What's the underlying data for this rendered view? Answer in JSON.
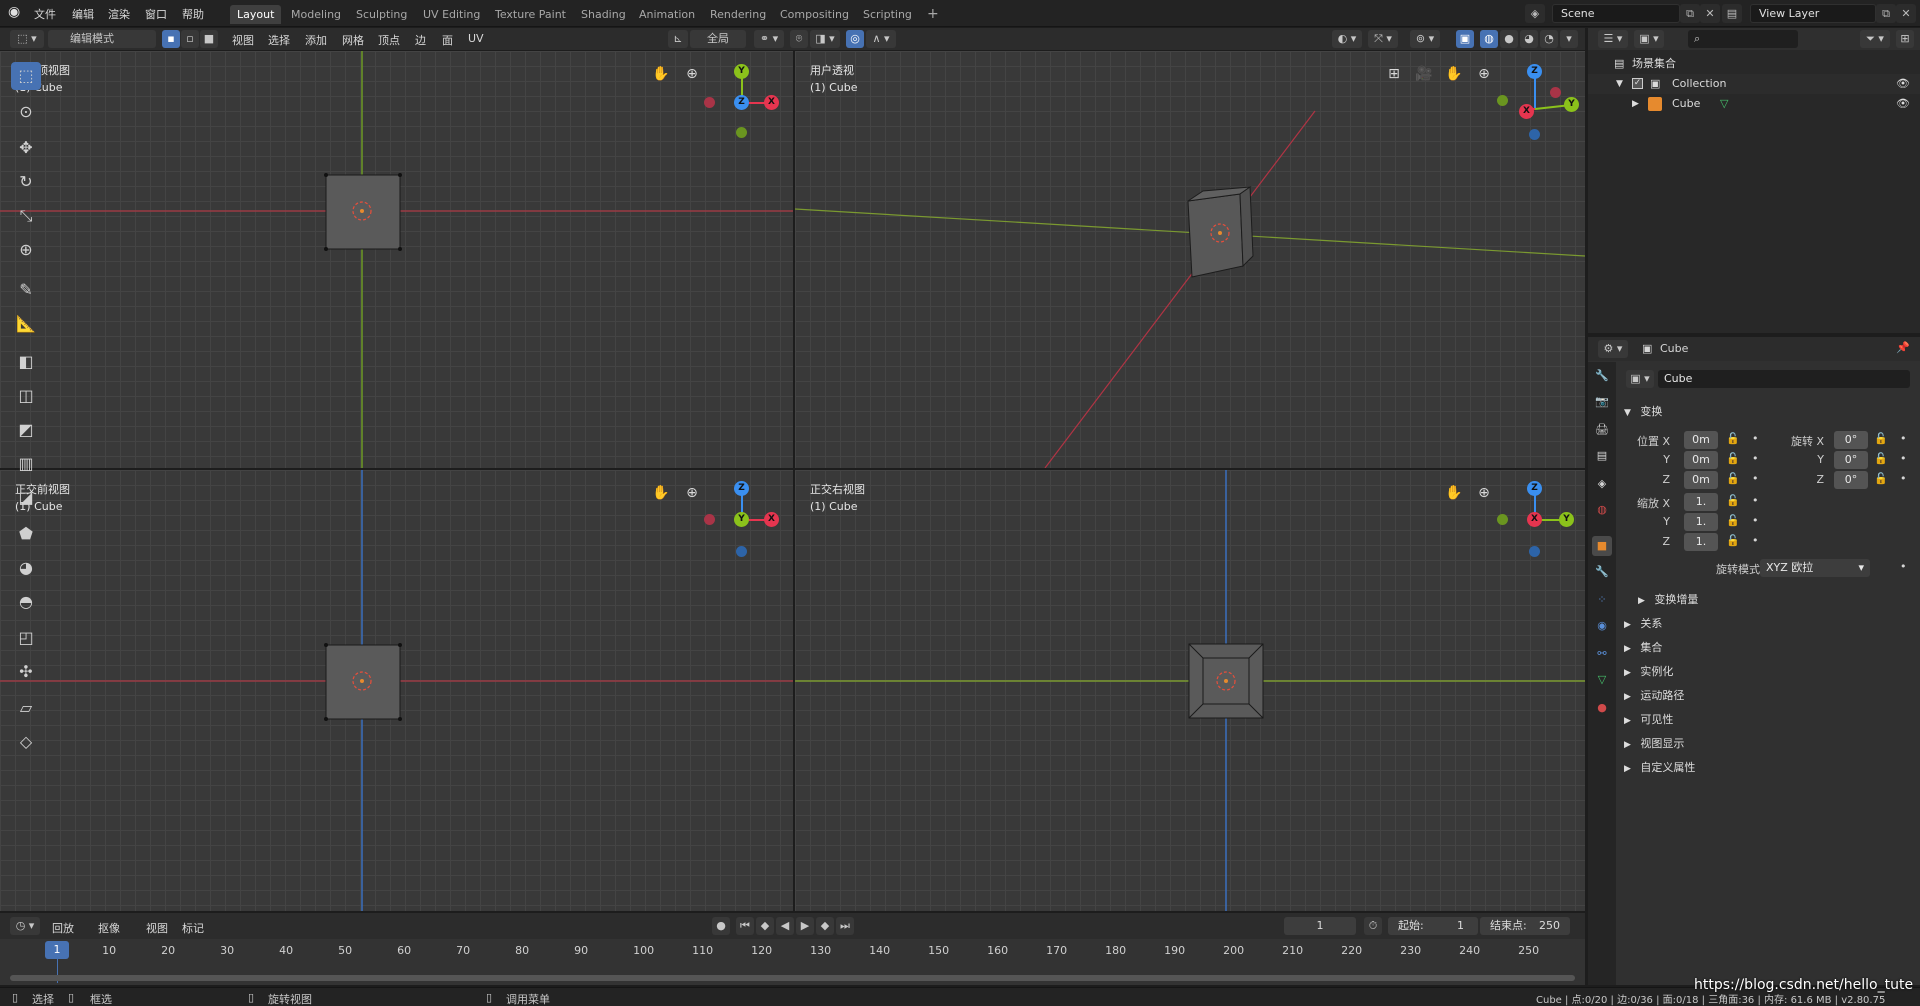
{
  "topbar": {
    "menus": [
      "文件",
      "编辑",
      "渲染",
      "窗口",
      "帮助"
    ],
    "workspaces": [
      {
        "label": "Layout",
        "active": true
      },
      {
        "label": "Modeling",
        "active": false
      },
      {
        "label": "Sculpting",
        "active": false
      },
      {
        "label": "UV Editing",
        "active": false
      },
      {
        "label": "Texture Paint",
        "active": false
      },
      {
        "label": "Shading",
        "active": false
      },
      {
        "label": "Animation",
        "active": false
      },
      {
        "label": "Rendering",
        "active": false
      },
      {
        "label": "Compositing",
        "active": false
      },
      {
        "label": "Scripting",
        "active": false
      }
    ],
    "add_workspace": "+",
    "scene": "Scene",
    "view_layer": "View Layer"
  },
  "viewport_header": {
    "mode": "编辑模式",
    "menus": [
      "视图",
      "选择",
      "添加",
      "网格",
      "顶点",
      "边",
      "面",
      "UV"
    ],
    "orientation": "全局"
  },
  "viewports": {
    "top_left": {
      "title": "正交顶视图",
      "object": "(1) Cube",
      "gizmo_labels": [
        "Y",
        "Z",
        "X"
      ]
    },
    "top_right": {
      "title": "用户透视",
      "object": "(1) Cube",
      "gizmo_labels": [
        "Z",
        "X",
        "Y"
      ]
    },
    "bottom_left": {
      "title": "正交前视图",
      "object": "(1) Cube",
      "gizmo_labels": [
        "Z",
        "Y",
        "X"
      ]
    },
    "bottom_right": {
      "title": "正交右视图",
      "object": "(1) Cube",
      "gizmo_labels": [
        "Z",
        "X",
        "Y"
      ]
    }
  },
  "outliner": {
    "root": "场景集合",
    "collection": "Collection",
    "object": "Cube"
  },
  "properties": {
    "object_name_header": "Cube",
    "object_name_field": "Cube",
    "transform_section": "变换",
    "location_label": "位置 X",
    "rotation_label": "旋转 X",
    "scale_label": "缩放 X",
    "axis_y": "Y",
    "axis_z": "Z",
    "location": [
      "0m",
      "0m",
      "0m"
    ],
    "rotation": [
      "0°",
      "0°",
      "0°"
    ],
    "scale": [
      "1.",
      "1.",
      "1."
    ],
    "rotation_mode_label": "旋转模式",
    "rotation_mode_value": "XYZ 欧拉",
    "delta_transform": "变换增量",
    "sections": [
      "关系",
      "集合",
      "实例化",
      "运动路径",
      "可见性",
      "视图显示",
      "自定义属性"
    ]
  },
  "timeline": {
    "menus": [
      "回放",
      "抠像",
      "视图",
      "标记"
    ],
    "current_frame": "1",
    "start_label": "起始:",
    "start_value": "1",
    "end_label": "结束点:",
    "end_value": "250",
    "ruler": [
      "1",
      "10",
      "20",
      "30",
      "40",
      "50",
      "60",
      "70",
      "80",
      "90",
      "100",
      "110",
      "120",
      "130",
      "140",
      "150",
      "160",
      "170",
      "180",
      "190",
      "200",
      "210",
      "220",
      "230",
      "240",
      "250"
    ]
  },
  "statusbar": {
    "select": "选择",
    "box_select": "框选",
    "rotate_view": "旋转视图",
    "call_menu": "调用菜单",
    "stats": "Cube | 点:0/20 | 边:0/36 | 面:0/18 | 三角面:36 | 内存: 61.6 MB | v2.80.75",
    "watermark": "https://blog.csdn.net/hello_tute"
  },
  "colors": {
    "accent": "#4772b3",
    "axis_x": "#e5354f",
    "axis_y": "#8bc21b",
    "axis_z": "#3a8ff0",
    "orange": "#e68a2e"
  }
}
